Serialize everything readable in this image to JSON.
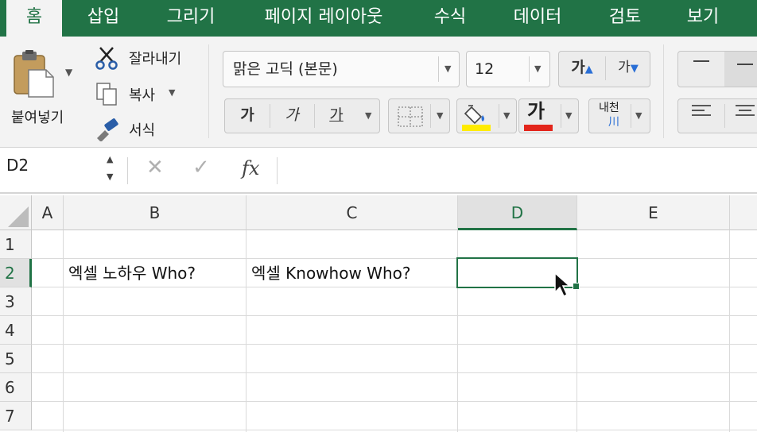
{
  "ribbon_tabs": [
    "홈",
    "삽입",
    "그리기",
    "페이지 레이아웃",
    "수식",
    "데이터",
    "검토",
    "보기"
  ],
  "active_tab": "홈",
  "clipboard": {
    "paste_label": "붙여넣기",
    "cut_label": "잘라내기",
    "copy_label": "복사",
    "format_painter_label": "서식"
  },
  "font": {
    "name": "맑은 고딕 (본문)",
    "size": "12",
    "grow_label": "가",
    "shrink_label": "가",
    "bold_label": "가",
    "italic_label": "가",
    "underline_label": "가",
    "font_color_label": "가",
    "phonetic_label_top": "내천",
    "phonetic_label_bottom": "川",
    "fill_color": "#ffeb00",
    "font_color": "#e3251b"
  },
  "formula_bar": {
    "name_box": "D2",
    "fx_label": "fx",
    "content": ""
  },
  "grid": {
    "columns": [
      "A",
      "B",
      "C",
      "D",
      "E"
    ],
    "rows": [
      "1",
      "2",
      "3",
      "4",
      "5",
      "6",
      "7"
    ],
    "selected_column": "D",
    "selected_row": "2",
    "cells": {
      "B2": "엑셀 노하우 Who?",
      "C2": "엑셀 Knowhow Who?"
    }
  },
  "colors": {
    "accent": "#217346"
  }
}
